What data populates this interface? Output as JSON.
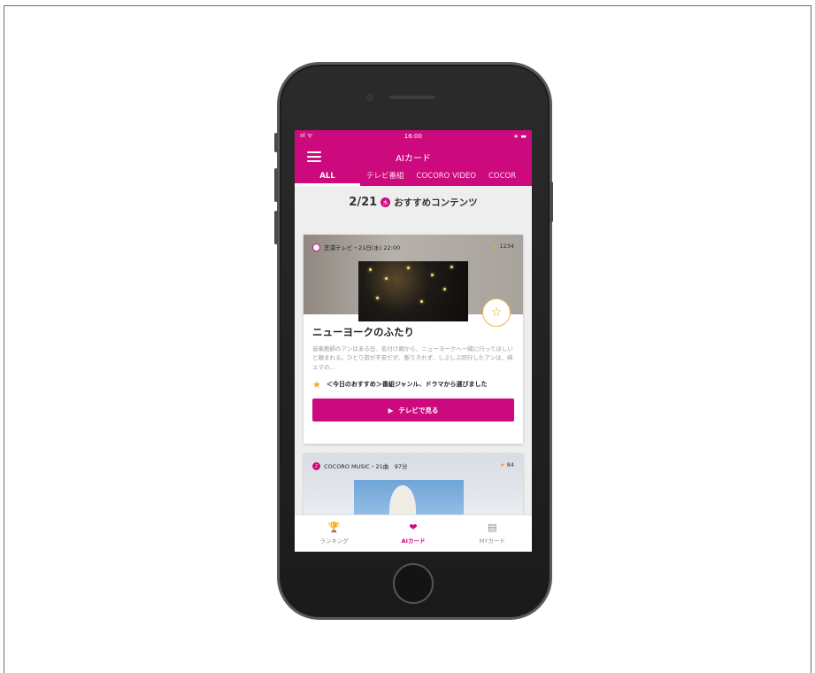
{
  "status": {
    "signal": "ııl ᯤ",
    "time": "16:00",
    "battery": "∗ ▬"
  },
  "app": {
    "title": "AIカード"
  },
  "tabs": [
    {
      "label": "ALL"
    },
    {
      "label": "テレビ番組"
    },
    {
      "label": "COCORO VIDEO"
    },
    {
      "label": "COCOR"
    }
  ],
  "date": {
    "date": "2/21",
    "day": "水",
    "label": "おすすめコンテンツ"
  },
  "card1": {
    "source": "芝浦テレビ・21日(水) 22:00",
    "rating": "1234",
    "title": "ニューヨークのふたり",
    "description": "音楽教師のアンはある日、名付け親から、ニューヨークへ一緒に行ってほしいと頼まれる。ひとり旅が不安だが、断りきれず、しぶしぶ同行したアンは、姉エマの…",
    "recommendation": "＜今日のおすすめ＞番組ジャンル、ドラマから選びました",
    "watch_label": "テレビで見る"
  },
  "card2": {
    "source": "COCORO MUSIC・21曲　97分",
    "rating": "84"
  },
  "nav": [
    {
      "label": "ランキング",
      "icon": "trophy-icon"
    },
    {
      "label": "AIカード",
      "icon": "heart-card-icon"
    },
    {
      "label": "MYカード",
      "icon": "cards-icon"
    }
  ],
  "colors": {
    "brand": "#cc0a7d",
    "star": "#f5a623"
  }
}
